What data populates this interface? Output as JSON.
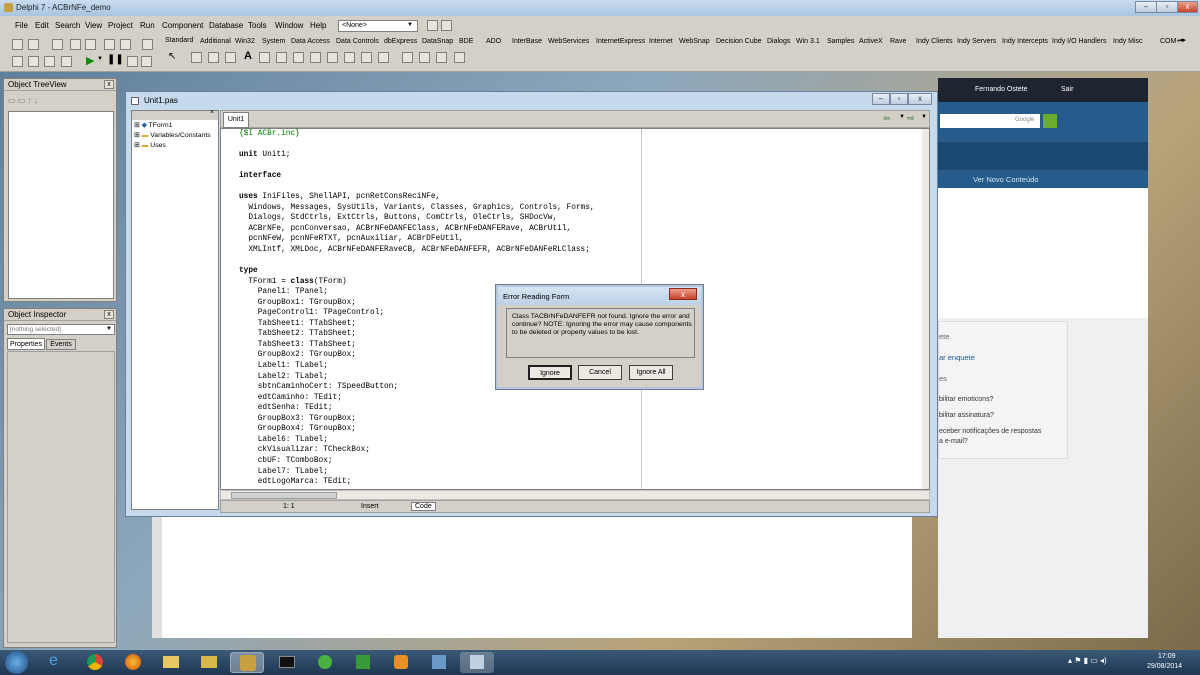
{
  "app_title": "Delphi 7 - ACBrNFe_demo",
  "menu": [
    "File",
    "Edit",
    "Search",
    "View",
    "Project",
    "Run",
    "Component",
    "Database",
    "Tools",
    "Window",
    "Help"
  ],
  "toolbar_combo": "<None>",
  "palette_tabs": [
    "Standard",
    "Additional",
    "Win32",
    "System",
    "Data Access",
    "Data Controls",
    "dbExpress",
    "DataSnap",
    "BDE",
    "ADO",
    "InterBase",
    "WebServices",
    "InternetExpress",
    "Internet",
    "WebSnap",
    "Decision Cube",
    "Dialogs",
    "Win 3.1",
    "Samples",
    "ActiveX",
    "Rave",
    "Indy Clients",
    "Indy Servers",
    "Indy Intercepts",
    "Indy I/O Handlers",
    "Indy Misc",
    "COM+"
  ],
  "object_treeview": {
    "title": "Object TreeView"
  },
  "object_inspector": {
    "title": "Object Inspector",
    "selector": "[nothing selected]",
    "tabs": [
      "Properties",
      "Events"
    ]
  },
  "editor": {
    "title": "Unit1.pas",
    "tab": "Unit1",
    "tree": [
      "TForm1",
      "Variables/Constants",
      "Uses"
    ],
    "status": {
      "position": "1: 1",
      "mode": "Insert",
      "view": "Code"
    }
  },
  "code_lines": [
    "{$I ACBr.inc}",
    "",
    "unit Unit1;",
    "",
    "interface",
    "",
    "uses IniFiles, ShellAPI, pcnRetConsReciNFe,",
    "  Windows, Messages, SysUtils, Variants, Classes, Graphics, Controls, Forms,",
    "  Dialogs, StdCtrls, ExtCtrls, Buttons, ComCtrls, OleCtrls, SHDocVw,",
    "  ACBrNFe, pcnConversao, ACBrNFeDANFEClass, ACBrNFeDANFERave, ACBrUtil,",
    "  pcnNFeW, pcnNFeRTXT, pcnAuxiliar, ACBrDFeUtil,",
    "  XMLIntf, XMLDoc, ACBrNFeDANFERaveCB, ACBrNFeDANFEFR, ACBrNFeDANFeRLClass;",
    "",
    "type",
    "  TForm1 = class(TForm)",
    "    Panel1: TPanel;",
    "    GroupBox1: TGroupBox;",
    "    PageControl1: TPageControl;",
    "    TabSheet1: TTabSheet;",
    "    TabSheet2: TTabSheet;",
    "    TabSheet3: TTabSheet;",
    "    GroupBox2: TGroupBox;",
    "    Label1: TLabel;",
    "    Label2: TLabel;",
    "    sbtnCaminhoCert: TSpeedButton;",
    "    edtCaminho: TEdit;",
    "    edtSenha: TEdit;",
    "    GroupBox3: TGroupBox;",
    "    GroupBox4: TGroupBox;",
    "    Label6: TLabel;",
    "    ckVisualizar: TCheckBox;",
    "    cbUF: TComboBox;",
    "    Label7: TLabel;",
    "    edtLogoMarca: TEdit;"
  ],
  "dialog": {
    "title": "Error Reading Form",
    "message": "Class TACBrNFeDANFEFR not found.  Ignore the error and continue?  NOTE: Ignoring the error may cause components to be deleted or property values to be lost.",
    "buttons": {
      "ignore": "Ignore",
      "cancel": "Cancel",
      "ignore_all": "Ignore All"
    },
    "close": "x"
  },
  "web": {
    "user": "Fernando Ostete",
    "logout": "Sair",
    "search_btn": "Google",
    "nav": "Ver Novo Conteúdo",
    "sidebar": {
      "h1": "ete",
      "link": "ar enquete",
      "h2": "es",
      "items": [
        "bilitar emoticons?",
        "bilitar assinatura?",
        "eceber notificações de respostas",
        "a e-mail?"
      ]
    }
  },
  "taskbar": {
    "time": "17:09",
    "date": "29/08/2014"
  }
}
